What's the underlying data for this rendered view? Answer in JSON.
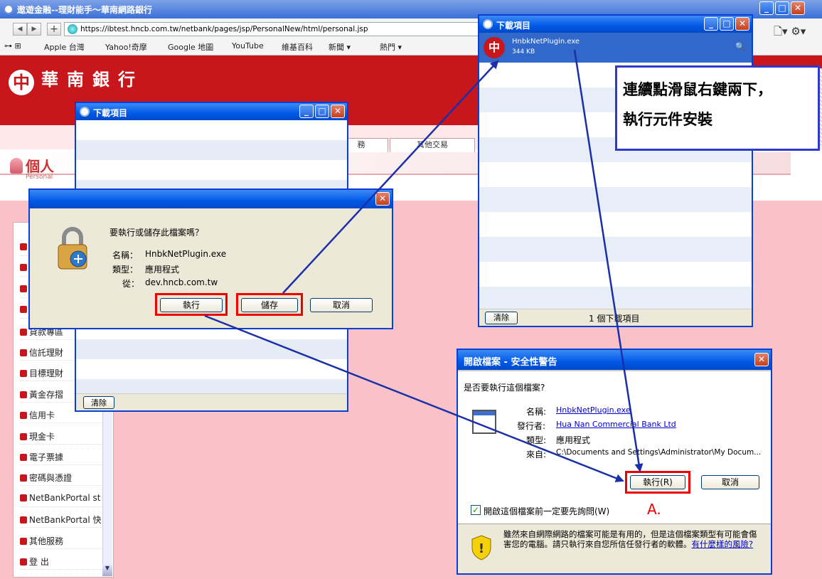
{
  "browser": {
    "title": "遨遊金融--理財能手～華南網路銀行",
    "url": "https://ibtest.hncb.com.tw/netbank/pages/jsp/PersonalNew/html/personal.jsp",
    "bookmarks": [
      "Apple 台灣",
      "Yahoo!奇摩",
      "Google 地圖",
      "YouTube",
      "維基百科",
      "新聞 ▾",
      "熱門 ▾"
    ]
  },
  "bank": {
    "name": "華南銀行",
    "menu_tabs": [
      "務",
      "其他交易"
    ],
    "personal": "個人",
    "personal_sub": "Personal"
  },
  "sidebar": {
    "items": [
      "",
      "",
      "",
      "",
      "貸款專區",
      "信託理財",
      "目標理財",
      "黃金存摺",
      "信用卡",
      "現金卡",
      "電子票據",
      "密碼與憑證",
      "NetBankPortal st",
      "NetBankPortal 快",
      "其他服務",
      "登 出"
    ]
  },
  "download_small": {
    "title": "下載項目",
    "clear": "清除"
  },
  "run_save_dialog": {
    "question": "要執行或儲存此檔案嗎？",
    "name_label": "名稱：",
    "name": "HnbkNetPlugin.exe",
    "type_label": "類型：",
    "type": "應用程式",
    "from_label": "從：",
    "from": "dev.hncb.com.tw",
    "run": "執行",
    "save": "儲存",
    "cancel": "取消"
  },
  "download_large": {
    "title": "下載項目",
    "file_name": "HnbkNetPlugin.exe",
    "file_size": "344 KB",
    "clear": "清除",
    "count": "1 個下載項目"
  },
  "security_dialog": {
    "title": "開啟檔案 - 安全性警告",
    "question": "是否要執行這個檔案?",
    "name_label": "名稱:",
    "name": "HnbkNetPlugin.exe",
    "publisher_label": "發行者:",
    "publisher": "Hua Nan Commercial Bank Ltd",
    "type_label": "類型:",
    "type": "應用程式",
    "from_label": "來自:",
    "from": "C:\\Documents and Settings\\Administrator\\My Docum...",
    "run": "執行(R)",
    "cancel": "取消",
    "checkbox": "開啟這個檔案前一定要先詢問(W)",
    "warning": "雖然來自網際網路的檔案可能是有用的，但是這個檔案類型有可能會傷害您的電腦。請只執行來自您所信任發行者的軟體。",
    "risk_link": "有什麼樣的風險?"
  },
  "annotation": {
    "line1": "連續點滑鼠右鍵兩下，",
    "line2": "執行元件安裝",
    "marker": "A."
  },
  "colors": {
    "bank_red": "#c7171c",
    "xp_blue": "#0058e6",
    "highlight_red": "#ee0000",
    "arrow_blue": "#1a2fa8"
  }
}
